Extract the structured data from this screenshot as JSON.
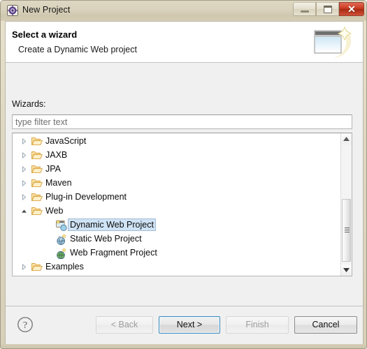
{
  "window": {
    "title": "New Project",
    "icon": "eclipse-new-project-icon",
    "controls": {
      "minimize": "–",
      "maximize": "□",
      "close": "✕"
    }
  },
  "banner": {
    "title": "Select a wizard",
    "subtitle": "Create a Dynamic Web project",
    "icon": "wizard-banner-icon"
  },
  "body": {
    "wizards_label": "Wizards:",
    "filter": {
      "value": "",
      "placeholder": "type filter text"
    }
  },
  "tree": {
    "items": [
      {
        "label": "JavaScript",
        "icon": "folder-icon",
        "level": 0,
        "expander": "collapsed",
        "selected": false
      },
      {
        "label": "JAXB",
        "icon": "folder-icon",
        "level": 0,
        "expander": "collapsed",
        "selected": false
      },
      {
        "label": "JPA",
        "icon": "folder-icon",
        "level": 0,
        "expander": "collapsed",
        "selected": false
      },
      {
        "label": "Maven",
        "icon": "folder-icon",
        "level": 0,
        "expander": "collapsed",
        "selected": false
      },
      {
        "label": "Plug-in Development",
        "icon": "folder-icon",
        "level": 0,
        "expander": "collapsed",
        "selected": false
      },
      {
        "label": "Web",
        "icon": "folder-icon",
        "level": 0,
        "expander": "expanded",
        "selected": false
      },
      {
        "label": "Dynamic Web Project",
        "icon": "dynamic-web-project-icon",
        "level": 1,
        "expander": "none",
        "selected": true
      },
      {
        "label": "Static Web Project",
        "icon": "static-web-project-icon",
        "level": 1,
        "expander": "none",
        "selected": false
      },
      {
        "label": "Web Fragment Project",
        "icon": "web-fragment-project-icon",
        "level": 1,
        "expander": "none",
        "selected": false
      },
      {
        "label": "Examples",
        "icon": "folder-icon",
        "level": 0,
        "expander": "collapsed",
        "selected": false
      }
    ],
    "scrollbar": {
      "up_arrow": "scroll-up-icon",
      "down_arrow": "scroll-down-icon"
    }
  },
  "footer": {
    "help": "help-icon",
    "buttons": [
      {
        "id": "back",
        "label": "< Back",
        "state": "disabled"
      },
      {
        "id": "next",
        "label": "Next >",
        "state": "default"
      },
      {
        "id": "finish",
        "label": "Finish",
        "state": "disabled"
      },
      {
        "id": "cancel",
        "label": "Cancel",
        "state": "normal"
      }
    ]
  },
  "colors": {
    "titlebar": "#d9d2bc",
    "dialog_bg": "#f0f0f0",
    "banner_bg": "#ffffff",
    "selection_bg": "#cfe3f5",
    "selection_border": "#a4bcd4",
    "default_button_border": "#3c8bbf",
    "close_button": "#cb3a21",
    "folder_icon": "#f0c060"
  }
}
